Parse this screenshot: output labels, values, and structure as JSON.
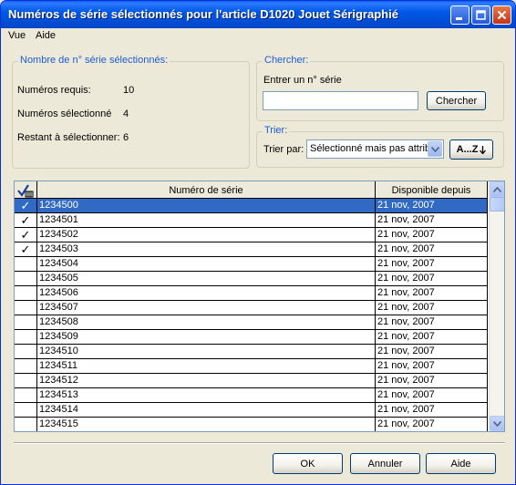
{
  "window": {
    "title": "Numéros de série sélectionnés pour l'article D1020 Jouet Sérigraphié"
  },
  "menu": {
    "items": [
      "Vue",
      "Aide"
    ]
  },
  "summary": {
    "legend": "Nombre de n° série sélectionnés:",
    "required_label": "Numéros requis:",
    "required_value": "10",
    "selected_label": "Numéros sélectionné",
    "selected_value": "4",
    "remaining_label": "Restant à sélectionner:",
    "remaining_value": "6"
  },
  "search": {
    "legend": "Chercher:",
    "prompt": "Entrer un n° série",
    "value": "",
    "button": "Chercher"
  },
  "sort": {
    "legend": "Trier:",
    "label": "Trier par:",
    "selected": "Sélectionné mais pas attrib",
    "button": "A...Z"
  },
  "table": {
    "headers": [
      "Numéro de série",
      "Disponible depuis"
    ],
    "rows": [
      {
        "checked": true,
        "serial": "1234500",
        "date": "21 nov, 2007",
        "selected": true
      },
      {
        "checked": true,
        "serial": "1234501",
        "date": "21 nov, 2007"
      },
      {
        "checked": true,
        "serial": "1234502",
        "date": "21 nov, 2007"
      },
      {
        "checked": true,
        "serial": "1234503",
        "date": "21 nov, 2007"
      },
      {
        "checked": false,
        "serial": "1234504",
        "date": "21 nov, 2007"
      },
      {
        "checked": false,
        "serial": "1234505",
        "date": "21 nov, 2007"
      },
      {
        "checked": false,
        "serial": "1234506",
        "date": "21 nov, 2007"
      },
      {
        "checked": false,
        "serial": "1234507",
        "date": "21 nov, 2007"
      },
      {
        "checked": false,
        "serial": "1234508",
        "date": "21 nov, 2007"
      },
      {
        "checked": false,
        "serial": "1234509",
        "date": "21 nov, 2007"
      },
      {
        "checked": false,
        "serial": "1234510",
        "date": "21 nov, 2007"
      },
      {
        "checked": false,
        "serial": "1234511",
        "date": "21 nov, 2007"
      },
      {
        "checked": false,
        "serial": "1234512",
        "date": "21 nov, 2007"
      },
      {
        "checked": false,
        "serial": "1234513",
        "date": "21 nov, 2007"
      },
      {
        "checked": false,
        "serial": "1234514",
        "date": "21 nov, 2007"
      },
      {
        "checked": false,
        "serial": "1234515",
        "date": "21 nov, 2007"
      }
    ]
  },
  "buttons": {
    "ok": "OK",
    "cancel": "Annuler",
    "help": "Aide"
  },
  "colors": {
    "titlebar": "#0058e6",
    "selection": "#316ac5",
    "legend": "#1d5bd6",
    "face": "#ece9d8"
  },
  "icons": [
    "minimize-icon",
    "maximize-icon",
    "close-icon",
    "checkbox-column-icon",
    "dropdown-arrow-icon",
    "sort-arrow-icon",
    "scroll-up-icon",
    "scroll-down-icon"
  ]
}
